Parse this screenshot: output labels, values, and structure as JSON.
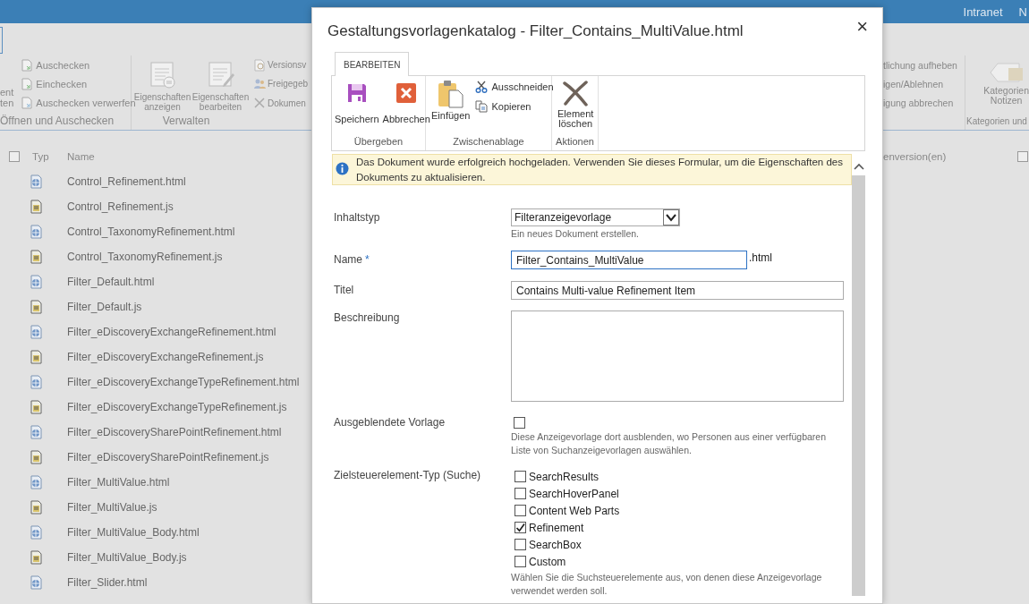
{
  "background": {
    "top_bar": {
      "links": [
        "Intranet",
        "N"
      ]
    },
    "ribbon": {
      "left_group": {
        "cut_button_lines": [
          "ent",
          "ten"
        ],
        "buttons": [
          "Auschecken",
          "Einchecken",
          "Auschecken verwerfen"
        ],
        "label": "Öffnen und Auschecken"
      },
      "manage_group": {
        "large_buttons": [
          {
            "lines": [
              "Eigenschaften",
              "anzeigen"
            ]
          },
          {
            "lines": [
              "Eigenschaften",
              "bearbeiten"
            ]
          }
        ],
        "buttons": [
          "Versionsv",
          "Freigegeb",
          "Dokumen"
        ],
        "label": "Verwalten"
      },
      "right_group": {
        "buttons": [
          "tlichung aufheben",
          "igen/Ablehnen",
          "igung abbrechen"
        ]
      },
      "tags_group": {
        "button_lines": [
          "Kategorien",
          "Notizen"
        ],
        "label": "Kategorien und"
      }
    },
    "list": {
      "select_all": {
        "checked": false
      },
      "columns": [
        "Typ",
        "Name"
      ],
      "column_right": "enversion(en)",
      "right_checkbox": {
        "checked": false
      },
      "rows": [
        {
          "kind": "html",
          "name": "Control_Refinement.html"
        },
        {
          "kind": "js",
          "name": "Control_Refinement.js"
        },
        {
          "kind": "html",
          "name": "Control_TaxonomyRefinement.html"
        },
        {
          "kind": "js",
          "name": "Control_TaxonomyRefinement.js"
        },
        {
          "kind": "html",
          "name": "Filter_Default.html"
        },
        {
          "kind": "js",
          "name": "Filter_Default.js"
        },
        {
          "kind": "html",
          "name": "Filter_eDiscoveryExchangeRefinement.html"
        },
        {
          "kind": "js",
          "name": "Filter_eDiscoveryExchangeRefinement.js"
        },
        {
          "kind": "html",
          "name": "Filter_eDiscoveryExchangeTypeRefinement.html"
        },
        {
          "kind": "js",
          "name": "Filter_eDiscoveryExchangeTypeRefinement.js"
        },
        {
          "kind": "html",
          "name": "Filter_eDiscoverySharePointRefinement.html"
        },
        {
          "kind": "js",
          "name": "Filter_eDiscoverySharePointRefinement.js"
        },
        {
          "kind": "html",
          "name": "Filter_MultiValue.html"
        },
        {
          "kind": "js",
          "name": "Filter_MultiValue.js"
        },
        {
          "kind": "html",
          "name": "Filter_MultiValue_Body.html"
        },
        {
          "kind": "js",
          "name": "Filter_MultiValue_Body.js"
        },
        {
          "kind": "html",
          "name": "Filter_Slider.html"
        }
      ]
    }
  },
  "dialog": {
    "title": "Gestaltungsvorlagenkatalog - Filter_Contains_MultiValue.html",
    "close": "×",
    "ribbon": {
      "tab": {
        "label": "BEARBEITEN",
        "selected": true
      },
      "groups": [
        {
          "label": "Übergeben",
          "buttons": [
            {
              "kind": "save",
              "lines": [
                "Speichern"
              ]
            },
            {
              "kind": "cancel",
              "lines": [
                "Abbrechen"
              ]
            }
          ]
        },
        {
          "label": "Zwischenablage",
          "buttons": [
            {
              "kind": "paste",
              "lines": [
                "Einfügen"
              ]
            },
            {
              "kind": "cut",
              "lines": [
                "Ausschneiden"
              ]
            },
            {
              "kind": "copy",
              "lines": [
                "Kopieren"
              ]
            }
          ]
        },
        {
          "label": "Aktionen",
          "buttons": [
            {
              "kind": "delete",
              "lines": [
                "Element",
                "löschen"
              ]
            }
          ]
        }
      ]
    },
    "message": "Das Dokument wurde erfolgreich hochgeladen. Verwenden Sie dieses Formular, um die Eigenschaften des Dokuments zu aktualisieren.",
    "form": [
      {
        "kind": "select",
        "label": "Inhaltstyp",
        "value": "Filteranzeigevorlage",
        "hint": "Ein neues Dokument erstellen."
      },
      {
        "kind": "text",
        "label": "Name",
        "required_mark": "*",
        "value": "Filter_Contains_MultiValue",
        "suffix": ".html",
        "focused": true
      },
      {
        "kind": "text",
        "label": "Titel",
        "value": "Contains Multi-value Refinement Item",
        "focused": false
      },
      {
        "kind": "textarea",
        "label": "Beschreibung"
      },
      {
        "kind": "checkbox",
        "label": "Ausgeblendete Vorlage",
        "checked": false,
        "hint": "Diese Anzeigevorlage dort ausblenden, wo Personen aus einer verfügbaren Liste von Suchanzeigevorlagen auswählen."
      },
      {
        "kind": "checklist",
        "label": "Zielsteuerelement-Typ (Suche)",
        "options": [
          {
            "label": "SearchResults",
            "checked": false
          },
          {
            "label": "SearchHoverPanel",
            "checked": false
          },
          {
            "label": "Content Web Parts",
            "checked": false
          },
          {
            "label": "Refinement",
            "checked": true
          },
          {
            "label": "SearchBox",
            "checked": false
          },
          {
            "label": "Custom",
            "checked": false
          }
        ],
        "hint": "Wählen Sie die Suchsteuerelemente aus, von denen diese Anzeigevorlage verwendet werden soll."
      }
    ]
  }
}
